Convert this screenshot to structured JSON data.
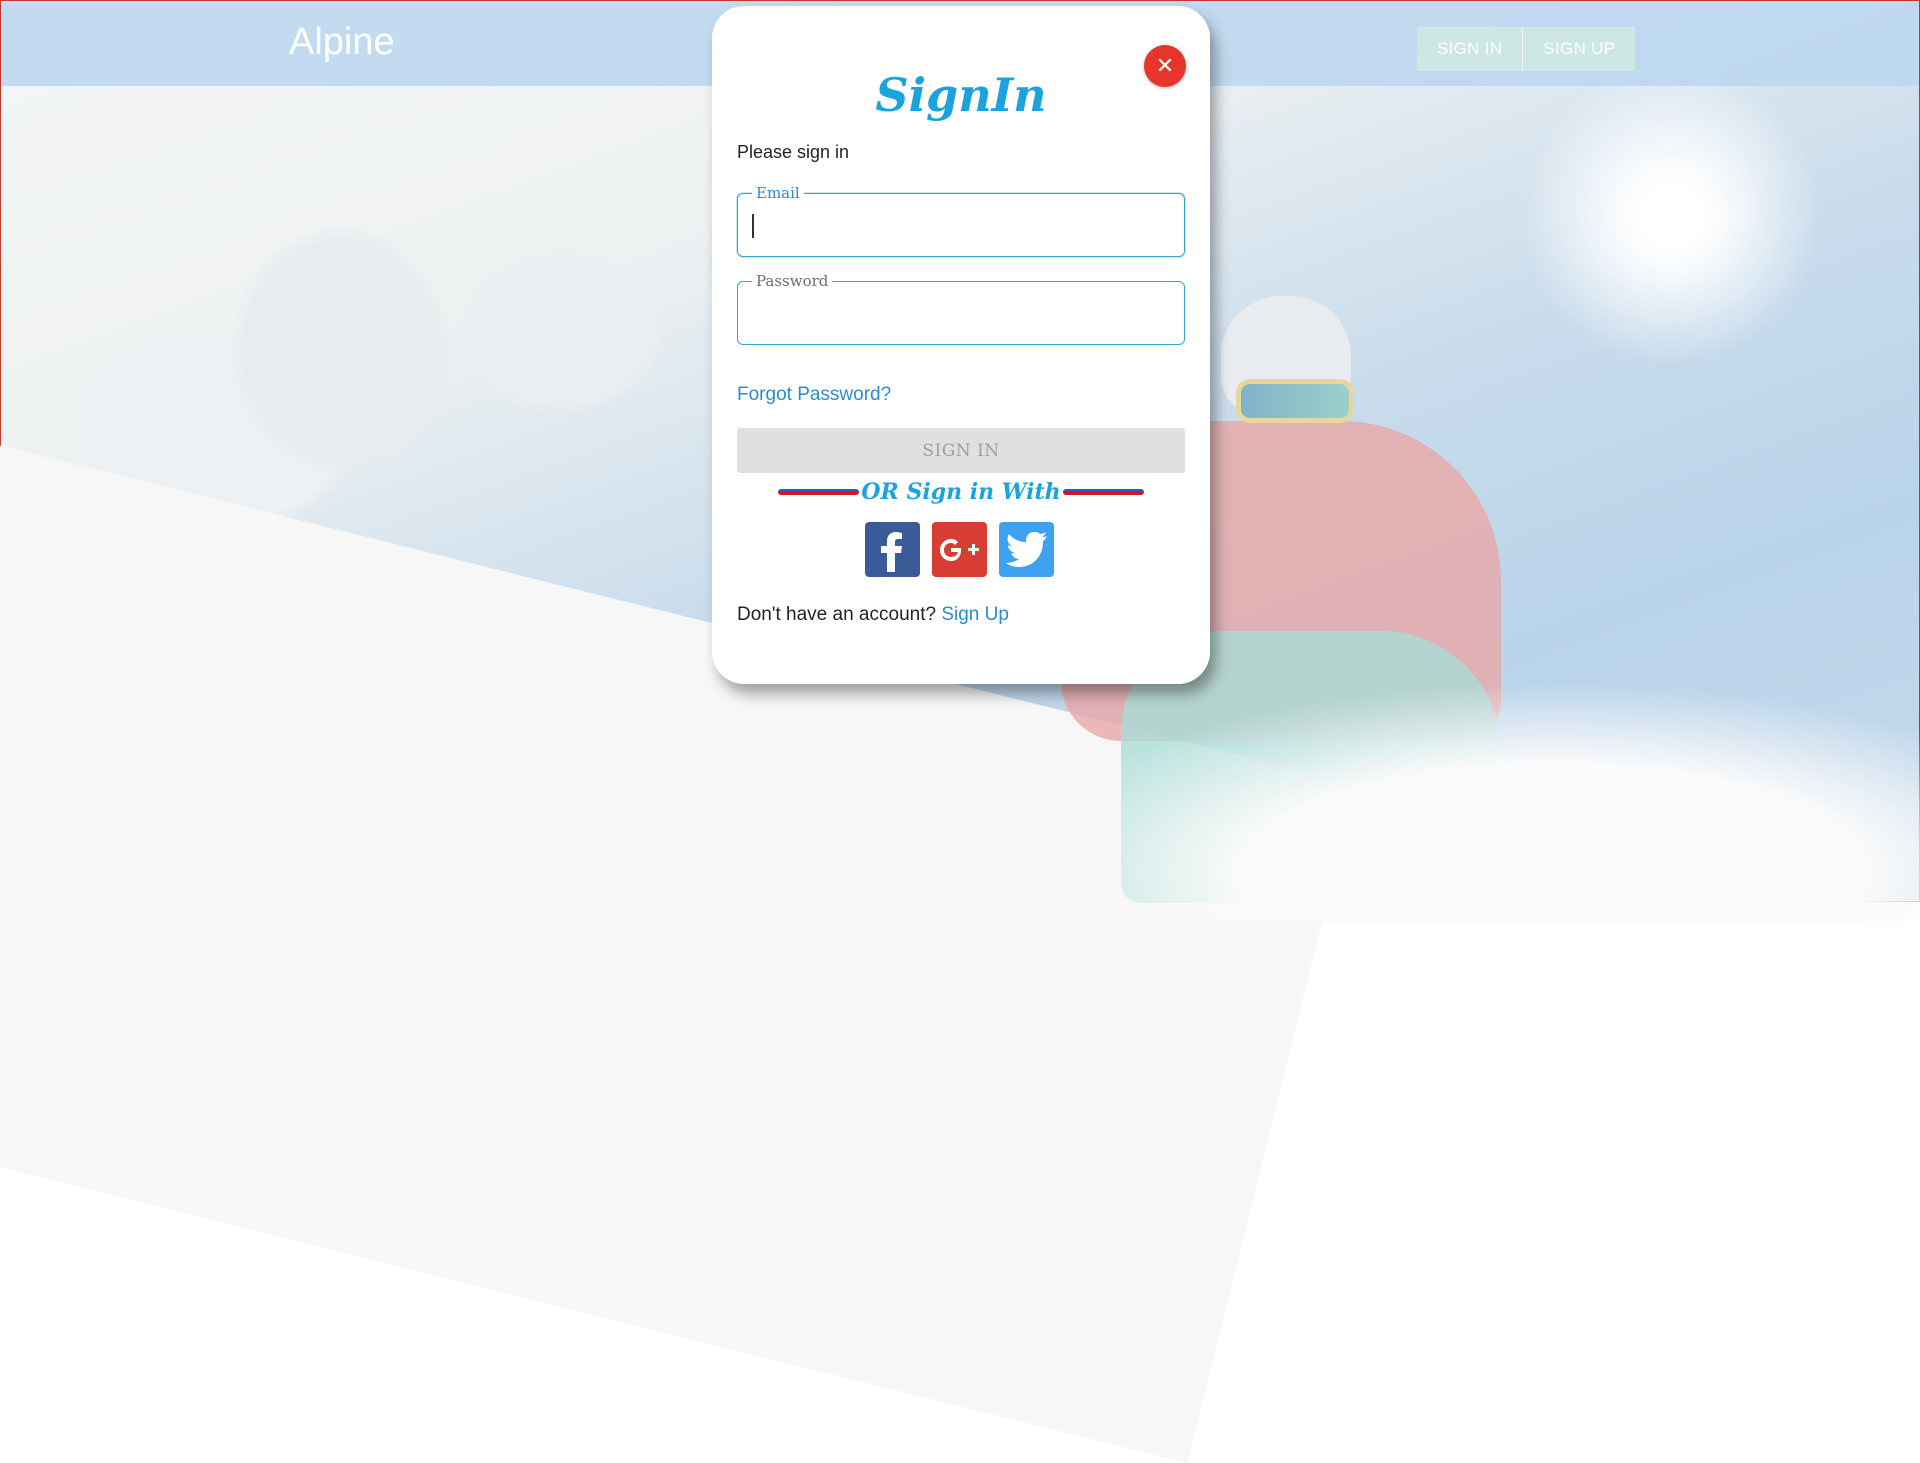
{
  "navbar": {
    "brand": "Alpine",
    "buttons": {
      "sign_in": "SIGN IN",
      "sign_up": "SIGN UP"
    }
  },
  "modal": {
    "close_icon": "close-icon",
    "title": "SignIn",
    "subtitle": "Please sign in",
    "email": {
      "label": "Email",
      "value": ""
    },
    "password": {
      "label": "Password",
      "value": ""
    },
    "forgot_password": "Forgot Password?",
    "sign_in_button": "SIGN IN",
    "divider_text": "OR Sign in With",
    "socials": [
      {
        "icon": "facebook-icon",
        "color": "#3b5a98"
      },
      {
        "icon": "google-plus-icon",
        "color": "#d73d32"
      },
      {
        "icon": "twitter-icon",
        "color": "#3fa1f1"
      }
    ],
    "no_account_text": "Don't have an account?",
    "sign_up_link": "Sign Up"
  },
  "colors": {
    "accent": "#1aa3df",
    "link": "#2a8ec7",
    "close": "#e8352b"
  }
}
